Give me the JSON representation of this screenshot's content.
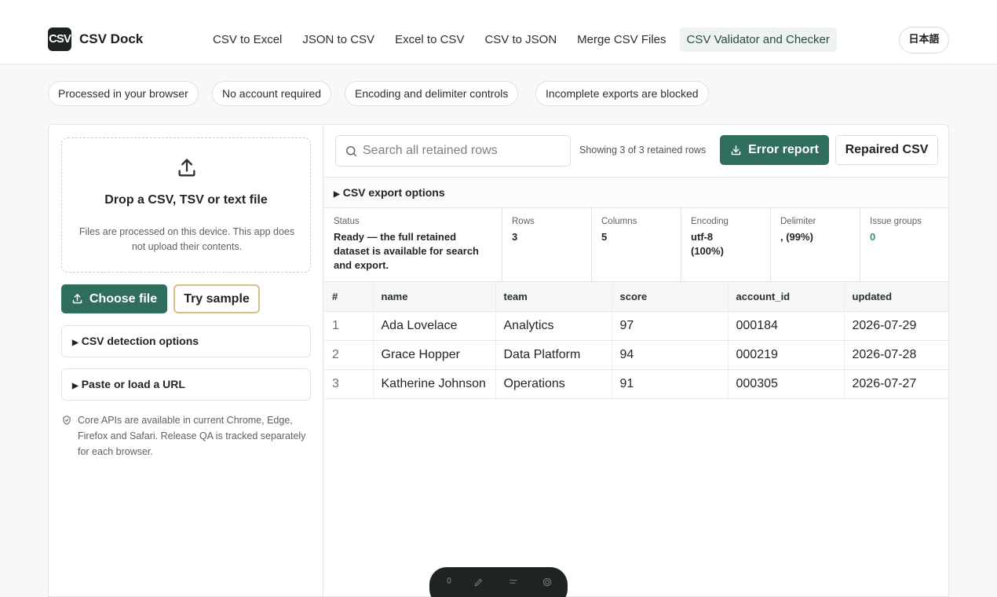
{
  "header": {
    "logo_text": "CSV",
    "brand": "CSV Dock",
    "nav": [
      {
        "label": "CSV to Excel"
      },
      {
        "label": "JSON to CSV"
      },
      {
        "label": "Excel to CSV"
      },
      {
        "label": "CSV to JSON"
      },
      {
        "label": "Merge CSV Files"
      },
      {
        "label": "CSV Validator and Checker",
        "active": true
      }
    ],
    "language": "日本語"
  },
  "chips": [
    "Processed in your browser",
    "No account required",
    "Encoding and delimiter controls",
    "Incomplete exports are blocked"
  ],
  "left": {
    "dropzone_title": "Drop a CSV, TSV or text file",
    "dropzone_text": "Files are processed on this device. This app does not upload their contents.",
    "choose_file": "Choose file",
    "try_sample": "Try sample",
    "detection_options": "CSV detection options",
    "paste_url": "Paste or load a URL",
    "note": "Core APIs are available in current Chrome, Edge, Firefox and Safari. Release QA is tracked separately for each browser."
  },
  "right": {
    "search_placeholder": "Search all retained rows",
    "showing": "Showing 3 of 3 retained rows",
    "error_report": "Error report",
    "repaired_csv": "Repaired CSV",
    "export_options": "CSV export options",
    "stats": [
      {
        "label": "Status",
        "value": "Ready — the full retained dataset is available for search and export."
      },
      {
        "label": "Rows",
        "value": "3"
      },
      {
        "label": "Columns",
        "value": "5"
      },
      {
        "label": "Encoding",
        "value": "utf-8 (100%)"
      },
      {
        "label": "Delimiter",
        "value": ", (99%)"
      },
      {
        "label": "Issue groups",
        "value": "0"
      }
    ],
    "table": {
      "headers": [
        "#",
        "name",
        "team",
        "score",
        "account_id",
        "updated"
      ],
      "rows": [
        [
          "1",
          "Ada Lovelace",
          "Analytics",
          "97",
          "000184",
          "2026-07-29"
        ],
        [
          "2",
          "Grace Hopper",
          "Data Platform",
          "94",
          "000219",
          "2026-07-28"
        ],
        [
          "3",
          "Katherine Johnson",
          "Operations",
          "91",
          "000305",
          "2026-07-27"
        ]
      ]
    }
  },
  "colors": {
    "accent": "#2f6d5d",
    "sample_border": "#d8bf86",
    "issue_zero": "#2f8f73"
  },
  "icons": [
    "upload-icon",
    "search-icon",
    "download-icon",
    "shield-check-icon"
  ]
}
